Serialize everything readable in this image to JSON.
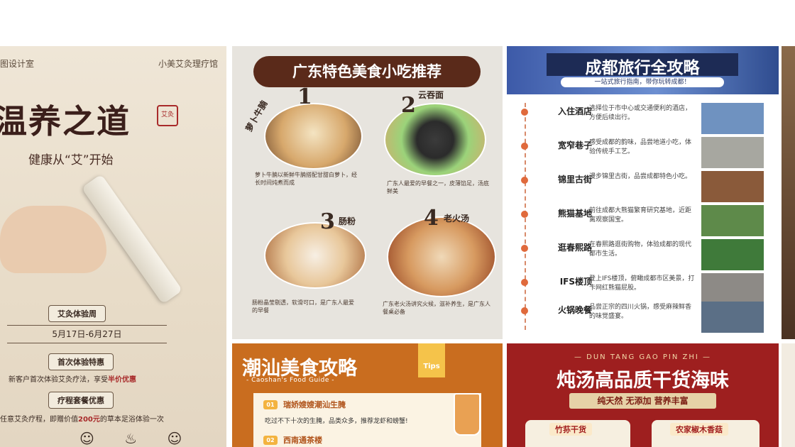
{
  "card1": {
    "top_left": "图设计室",
    "top_right": "小美艾灸理疗馆",
    "title": "温养之道",
    "seal": "艾灸",
    "subtitle": "健康从“艾”开始",
    "pill1": "艾灸体验周",
    "date": "5月17日-6月27日",
    "pill2": "首次体验特惠",
    "line1_prefix": "新客户首次体验艾灸疗法，享受",
    "line1_highlight": "半价优惠",
    "pill3": "疗程套餐优惠",
    "line2_prefix": "任意艾灸疗程，即赠价值",
    "line2_highlight": "200元",
    "line2_suffix": "的草本足浴体验一次",
    "icons": "☺ ♨ ☺"
  },
  "card2": {
    "title": "广东特色美食小吃推荐",
    "items": [
      {
        "num": "1",
        "label": "萝卜牛腩",
        "text": "萝卜牛腩以新鲜牛腩搭配甘甜白萝卜，经长时间炖煮而成"
      },
      {
        "num": "2",
        "label": "云吞面",
        "text": "广东人最爱的早餐之一，皮薄馅足，汤底鲜美"
      },
      {
        "num": "3",
        "label": "肠粉",
        "text": "肠粉晶莹剔透，软滑可口，是广东人最爱的早餐"
      },
      {
        "num": "4",
        "label": "老火汤",
        "text": "广东老火汤讲究火候，滋补养生，是广东人餐桌必备"
      }
    ]
  },
  "card3": {
    "title": "成都旅行全攻略",
    "subtitle": "一站式旅行指南，带你玩转成都！",
    "items": [
      {
        "name": "入住酒店",
        "desc": "选择位于市中心或交通便利的酒店，方便后续出行。",
        "color": "#6f92c0"
      },
      {
        "name": "宽窄巷子",
        "desc": "感受成都的韵味，品尝地道小吃，体验传统手工艺。",
        "color": "#a7a7a0"
      },
      {
        "name": "锦里古街",
        "desc": "漫步锦里古街，品尝成都特色小吃。",
        "color": "#8a5a3a"
      },
      {
        "name": "熊猫基地",
        "desc": "前往成都大熊猫繁育研究基地，近距离观察国宝。",
        "color": "#5e8a4a"
      },
      {
        "name": "逛春熙路",
        "desc": "在春熙路逛街购物，体验成都的现代都市生活。",
        "color": "#3f7a3a"
      },
      {
        "name": "IFS楼顶",
        "desc": "登上IFS楼顶，俯瞰成都市区美景，打卡网红熊猫屁股。",
        "color": "#8d8a86"
      },
      {
        "name": "火锅晚餐",
        "desc": "品尝正宗的四川火锅，感受麻辣鲜香的味觉盛宴。",
        "color": "#5b6f86"
      }
    ]
  },
  "card5": {
    "title": "潮汕美食攻略",
    "subtitle": "- Caoshan's Food Guide -",
    "tips": "Tips",
    "items": [
      {
        "badge": "01",
        "name": "瑞娇嫂嫂潮汕生腌",
        "desc": "吃过不下十次的生腌，品类众多，推荐龙虾和螃蟹!"
      },
      {
        "badge": "02",
        "name": "西南通茶楼",
        "desc": ""
      }
    ]
  },
  "card6": {
    "top": "— DUN TANG GAO PIN ZHI —",
    "title": "炖汤高品质干货海味",
    "band": "纯天然 无添加 营养丰富",
    "labels": [
      "竹荪干货",
      "农家椒木香菇"
    ]
  },
  "colors": {
    "accent_red": "#a82a2a",
    "c5_orange": "#c96d1f",
    "c6_red": "#9e1f1f",
    "c3_blue": "#3d5aa8"
  }
}
